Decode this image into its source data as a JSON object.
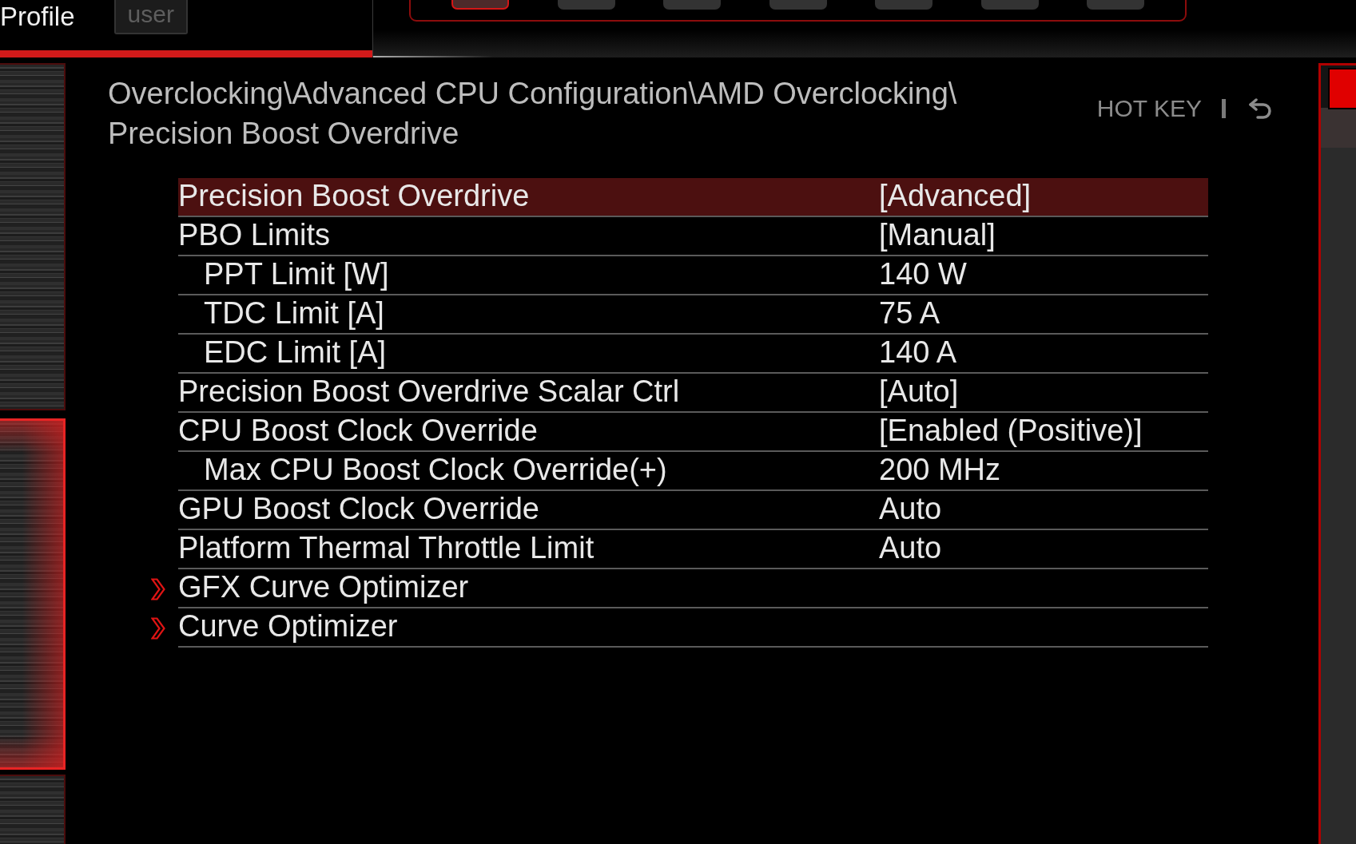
{
  "header": {
    "profile_label": "Profile",
    "profile_button": "user"
  },
  "mode_tabs": [
    {
      "selected": true
    },
    {
      "selected": false
    },
    {
      "selected": false
    },
    {
      "selected": false
    },
    {
      "selected": false
    },
    {
      "selected": false
    },
    {
      "selected": false
    }
  ],
  "side_tiles": [
    {
      "selected": false
    },
    {
      "selected": true
    },
    {
      "selected": false
    }
  ],
  "breadcrumb": [
    "Overclocking\\",
    "Advanced CPU Configuration\\",
    "AMD Overclocking\\",
    "Precision Boost Overdrive"
  ],
  "hotkey": {
    "label": "HOT KEY"
  },
  "settings": [
    {
      "kind": "setting",
      "label": "Precision Boost Overdrive",
      "value": "[Advanced]",
      "selected": true
    },
    {
      "kind": "setting",
      "label": "PBO Limits",
      "value": "[Manual]",
      "selected": false,
      "children": [
        {
          "kind": "setting",
          "label": "PPT Limit [W]",
          "value": "140 W",
          "selected": false
        },
        {
          "kind": "setting",
          "label": "TDC Limit [A]",
          "value": "75 A",
          "selected": false
        },
        {
          "kind": "setting",
          "label": "EDC Limit [A]",
          "value": "140 A",
          "selected": false
        }
      ]
    },
    {
      "kind": "setting",
      "label": "Precision Boost Overdrive Scalar Ctrl",
      "value": "[Auto]",
      "selected": false
    },
    {
      "kind": "setting",
      "label": "CPU Boost Clock Override",
      "value": "[Enabled (Positive)]",
      "selected": false,
      "children": [
        {
          "kind": "setting",
          "label": "Max CPU Boost Clock Override(+)",
          "value": "200 MHz",
          "selected": false
        }
      ]
    },
    {
      "kind": "setting",
      "label": "GPU Boost Clock Override",
      "value": "Auto",
      "selected": false
    },
    {
      "kind": "setting",
      "label": "Platform Thermal Throttle Limit",
      "value": "Auto",
      "selected": false
    },
    {
      "kind": "submenu",
      "label": "GFX Curve Optimizer",
      "selected": false
    },
    {
      "kind": "submenu",
      "label": "Curve Optimizer",
      "selected": false
    }
  ]
}
